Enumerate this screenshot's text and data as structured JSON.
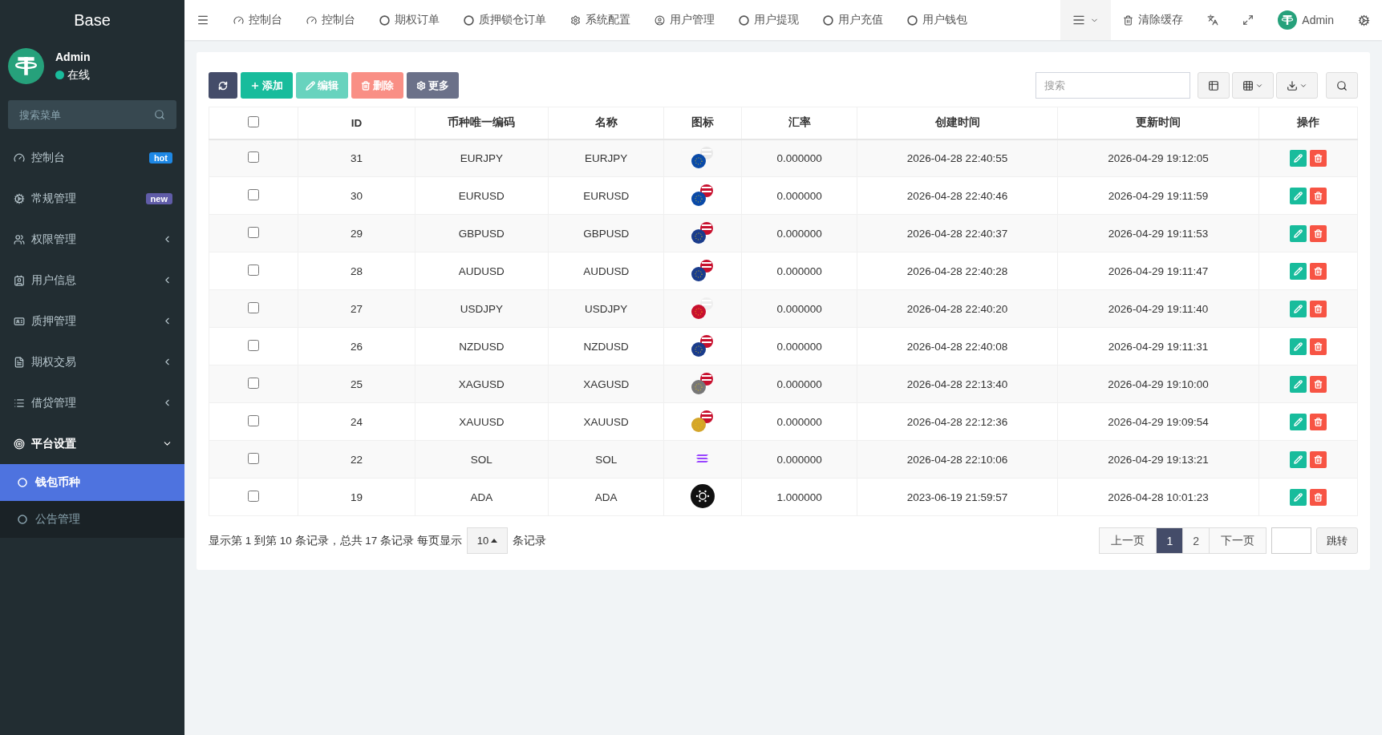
{
  "sidebar": {
    "logo": "Base",
    "user": {
      "name": "Admin",
      "status": "在线",
      "online": true
    },
    "search": {
      "placeholder": "搜索菜单"
    },
    "items": [
      {
        "label": "控制台",
        "badge": {
          "text": "hot",
          "color": "#1e88e5"
        }
      },
      {
        "label": "常规管理",
        "badge": {
          "text": "new",
          "color": "#605ca8"
        }
      },
      {
        "label": "权限管理",
        "expanded": false
      },
      {
        "label": "用户信息",
        "expanded": false
      },
      {
        "label": "质押管理",
        "expanded": false
      },
      {
        "label": "期权交易",
        "expanded": false
      },
      {
        "label": "借贷管理",
        "expanded": false
      },
      {
        "label": "平台设置",
        "expanded": true,
        "children": [
          {
            "label": "钱包币种",
            "selected": true
          },
          {
            "label": "公告管理",
            "selected": false
          }
        ]
      }
    ]
  },
  "topnav": {
    "items": [
      {
        "label": "控制台"
      },
      {
        "label": "控制台"
      },
      {
        "label": "期权订单"
      },
      {
        "label": "质押锁仓订单"
      },
      {
        "label": "系统配置"
      },
      {
        "label": "用户管理"
      },
      {
        "label": "用户提现"
      },
      {
        "label": "用户充值"
      },
      {
        "label": "用户钱包"
      }
    ],
    "clear_cache": "清除缓存",
    "user": "Admin"
  },
  "toolbar": {
    "buttons": [
      {
        "kind": "refresh",
        "disabled": false
      },
      {
        "kind": "add",
        "label": "添加",
        "disabled": false
      },
      {
        "kind": "edit",
        "label": "编辑",
        "disabled": true
      },
      {
        "kind": "delete",
        "label": "删除",
        "disabled": true
      },
      {
        "kind": "more",
        "label": "更多",
        "disabled": false
      }
    ],
    "search": {
      "placeholder": "搜索"
    }
  },
  "table": {
    "all_checked": false,
    "columns": [
      "ID",
      "币种唯一编码",
      "名称",
      "图标",
      "汇率",
      "创建时间",
      "更新时间",
      "操作"
    ],
    "rows": [
      {
        "checked": false,
        "cells": [
          "31",
          "EURJPY",
          "EURJPY",
          "",
          "0.000000",
          "2026-04-28 22:40:55",
          "2026-04-29 19:12:05"
        ]
      },
      {
        "checked": false,
        "cells": [
          "30",
          "EURUSD",
          "EURUSD",
          "",
          "0.000000",
          "2026-04-28 22:40:46",
          "2026-04-29 19:11:59"
        ]
      },
      {
        "checked": false,
        "cells": [
          "29",
          "GBPUSD",
          "GBPUSD",
          "",
          "0.000000",
          "2026-04-28 22:40:37",
          "2026-04-29 19:11:53"
        ]
      },
      {
        "checked": false,
        "cells": [
          "28",
          "AUDUSD",
          "AUDUSD",
          "",
          "0.000000",
          "2026-04-28 22:40:28",
          "2026-04-29 19:11:47"
        ]
      },
      {
        "checked": false,
        "cells": [
          "27",
          "USDJPY",
          "USDJPY",
          "",
          "0.000000",
          "2026-04-28 22:40:20",
          "2026-04-29 19:11:40"
        ]
      },
      {
        "checked": false,
        "cells": [
          "26",
          "NZDUSD",
          "NZDUSD",
          "",
          "0.000000",
          "2026-04-28 22:40:08",
          "2026-04-29 19:11:31"
        ]
      },
      {
        "checked": false,
        "cells": [
          "25",
          "XAGUSD",
          "XAGUSD",
          "",
          "0.000000",
          "2026-04-28 22:13:40",
          "2026-04-29 19:10:00"
        ]
      },
      {
        "checked": false,
        "cells": [
          "24",
          "XAUUSD",
          "XAUUSD",
          "",
          "0.000000",
          "2026-04-28 22:12:36",
          "2026-04-29 19:09:54"
        ]
      },
      {
        "checked": false,
        "cells": [
          "22",
          "SOL",
          "SOL",
          "",
          "0.000000",
          "2026-04-28 22:10:06",
          "2026-04-29 19:13:21"
        ]
      },
      {
        "checked": false,
        "cells": [
          "19",
          "ADA",
          "ADA",
          "",
          "1.000000",
          "2023-06-19 21:59:57",
          "2026-04-28 10:01:23"
        ]
      }
    ]
  },
  "footer": {
    "info": "显示第 1 到第 10 条记录，总共 17 条记录 每页显示",
    "page_size": "10",
    "suffix": "条记录"
  },
  "pagination": {
    "prev": "上一页",
    "pages": [
      {
        "label": "1",
        "selected": true
      },
      {
        "label": "2",
        "selected": false
      }
    ],
    "next": "下一页",
    "jump": "跳转"
  }
}
